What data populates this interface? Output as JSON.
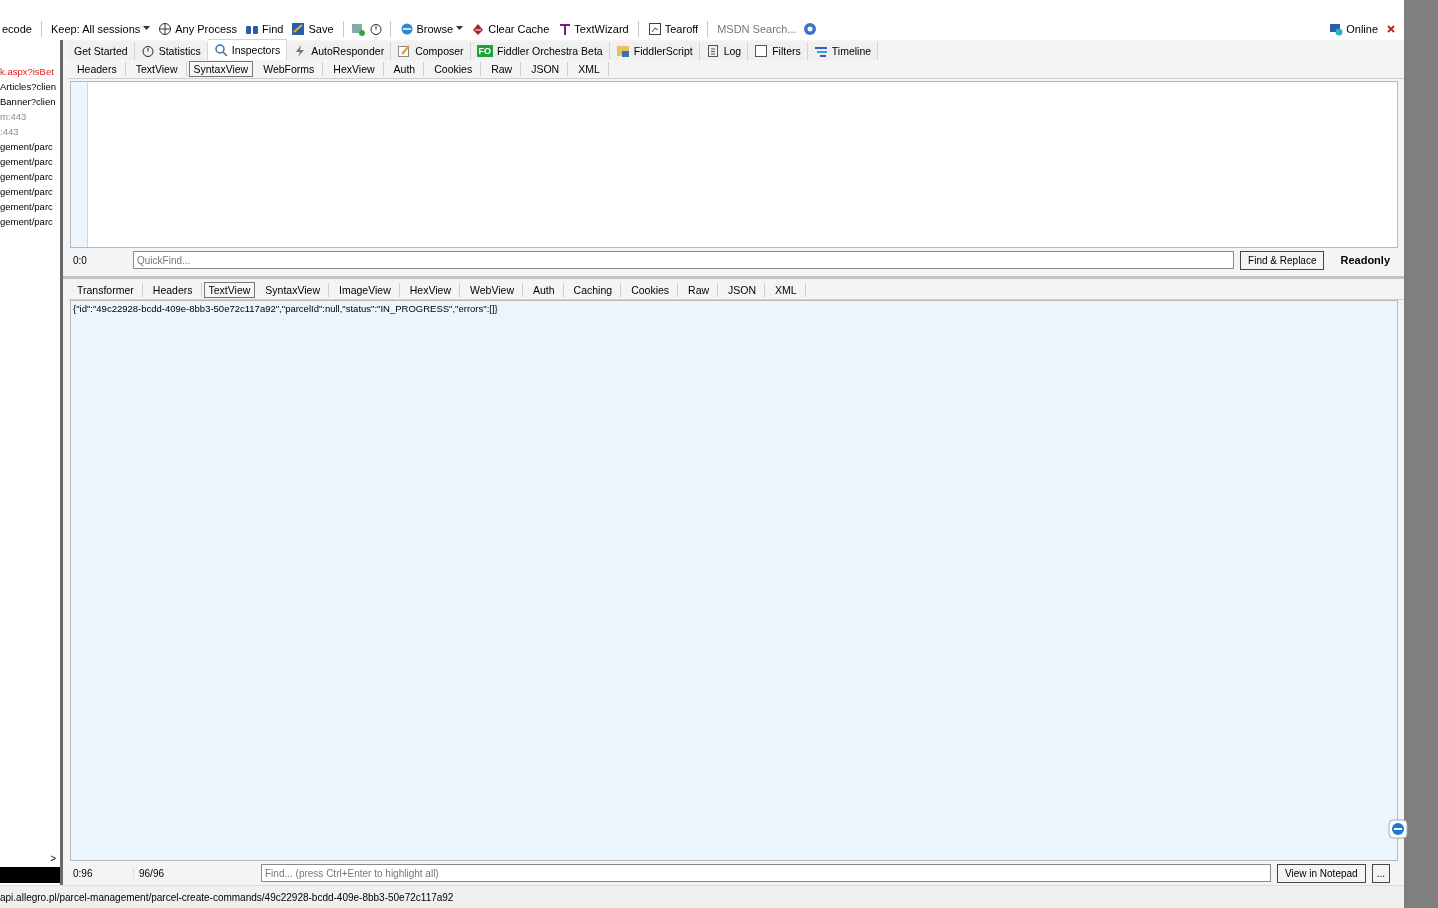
{
  "toolbar": {
    "items": [
      {
        "label": "ecode"
      },
      {
        "label": "Keep: All sessions",
        "dropdown": true
      },
      {
        "label": "Any Process"
      },
      {
        "label": "Find"
      },
      {
        "label": "Save"
      },
      {
        "label": "Browse",
        "dropdown": true
      },
      {
        "label": "Clear Cache"
      },
      {
        "label": "TextWizard"
      },
      {
        "label": "Tearoff"
      }
    ],
    "search": {
      "placeholder": "MSDN Search..."
    },
    "status": "Online"
  },
  "sessions": [
    {
      "text": "k.aspx?isBet",
      "kind": "error"
    },
    {
      "text": "Articles?clien",
      "kind": "normal"
    },
    {
      "text": "Banner?clien",
      "kind": "normal"
    },
    {
      "text": "m:443",
      "kind": "tunnel"
    },
    {
      "text": ":443",
      "kind": "tunnel"
    },
    {
      "text": "gement/parc",
      "kind": "normal"
    },
    {
      "text": "gement/parc",
      "kind": "normal"
    },
    {
      "text": "gement/parc",
      "kind": "normal"
    },
    {
      "text": "gement/parc",
      "kind": "normal"
    },
    {
      "text": "gement/parc",
      "kind": "normal"
    },
    {
      "text": "gement/parc",
      "kind": "normal"
    }
  ],
  "tabs": [
    {
      "label": "Get Started",
      "selected": false
    },
    {
      "label": "Statistics",
      "selected": false
    },
    {
      "label": "Inspectors",
      "selected": true
    },
    {
      "label": "AutoResponder",
      "selected": false
    },
    {
      "label": "Composer",
      "selected": false
    },
    {
      "label": "Fiddler Orchestra Beta",
      "badge": "FO",
      "selected": false
    },
    {
      "label": "FiddlerScript",
      "selected": false
    },
    {
      "label": "Log",
      "selected": false
    },
    {
      "label": "Filters",
      "selected": false
    },
    {
      "label": "Timeline",
      "selected": false
    }
  ],
  "request": {
    "tabs": [
      {
        "label": "Headers",
        "selected": false
      },
      {
        "label": "TextView",
        "selected": false
      },
      {
        "label": "SyntaxView",
        "selected": true
      },
      {
        "label": "WebForms",
        "selected": false
      },
      {
        "label": "HexView",
        "selected": false
      },
      {
        "label": "Auth",
        "selected": false
      },
      {
        "label": "Cookies",
        "selected": false
      },
      {
        "label": "Raw",
        "selected": false
      },
      {
        "label": "JSON",
        "selected": false
      },
      {
        "label": "XML",
        "selected": false
      }
    ],
    "position": "0:0",
    "quickfind": {
      "placeholder": "QuickFind..."
    },
    "button": "Find & Replace",
    "mode": "Readonly"
  },
  "response": {
    "tabs": [
      {
        "label": "Transformer",
        "selected": false
      },
      {
        "label": "Headers",
        "selected": false
      },
      {
        "label": "TextView",
        "selected": true
      },
      {
        "label": "SyntaxView",
        "selected": false
      },
      {
        "label": "ImageView",
        "selected": false
      },
      {
        "label": "HexView",
        "selected": false
      },
      {
        "label": "WebView",
        "selected": false
      },
      {
        "label": "Auth",
        "selected": false
      },
      {
        "label": "Caching",
        "selected": false
      },
      {
        "label": "Cookies",
        "selected": false
      },
      {
        "label": "Raw",
        "selected": false
      },
      {
        "label": "JSON",
        "selected": false
      },
      {
        "label": "XML",
        "selected": false
      }
    ],
    "body": "{\"id\":\"49c22928-bcdd-409e-8bb3-50e72c117a92\",\"parcelId\":null,\"status\":\"IN_PROGRESS\",\"errors\":[]}",
    "position": "0:96",
    "count": "96/96",
    "find": {
      "placeholder": "Find... (press Ctrl+Enter to highlight all)"
    },
    "button": "View in Notepad",
    "more": "..."
  },
  "sessions_scroll": ">",
  "status_bar": "api.allegro.pl/parcel-management/parcel-create-commands/49c22928-bcdd-409e-8bb3-50e72c117a92"
}
